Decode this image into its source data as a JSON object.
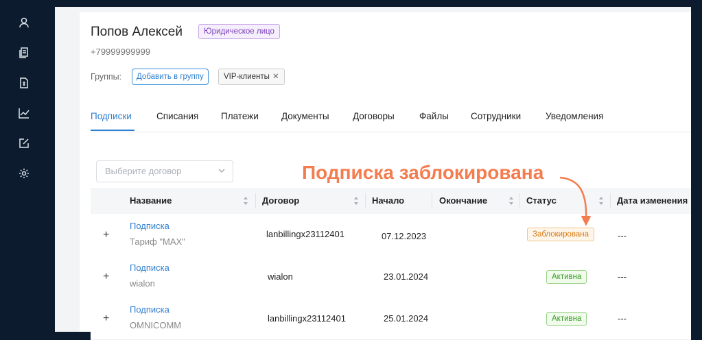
{
  "sidebar": {
    "icons": [
      "user-icon",
      "documents-icon",
      "invoice-icon",
      "chart-icon",
      "edit-icon",
      "gear-icon"
    ]
  },
  "client": {
    "name": "Попов Алексей",
    "type_badge": "Юридическое лицо",
    "phone": "+79999999999",
    "groups_label": "Группы:",
    "add_group_label": "Добавить в группу",
    "group_tag": "VIP-клиенты"
  },
  "tabs": [
    {
      "label": "Подписки"
    },
    {
      "label": "Списания"
    },
    {
      "label": "Платежи"
    },
    {
      "label": "Документы"
    },
    {
      "label": "Договоры"
    },
    {
      "label": "Файлы"
    },
    {
      "label": "Сотрудники"
    },
    {
      "label": "Уведомления"
    }
  ],
  "filter": {
    "placeholder": "Выберите договор"
  },
  "table": {
    "columns": [
      "Название",
      "Договор",
      "Начало",
      "Окончание",
      "Статус",
      "Дата изменения"
    ],
    "rows": [
      {
        "name": "Подписка",
        "tariff": "Тариф \"MAX\"",
        "contract": "lanbillingx23112401",
        "start": "07.12.2023",
        "end": "",
        "status": "Заблокирована",
        "changed": "---"
      },
      {
        "name": "Подписка",
        "tariff": "wialon",
        "contract": "wialon",
        "start": "23.01.2024",
        "end": "",
        "status": "Активна",
        "changed": "---"
      },
      {
        "name": "Подписка",
        "tariff": "OMNICOMM",
        "contract": "lanbillingx23112401",
        "start": "25.01.2024",
        "end": "",
        "status": "Активна",
        "changed": "---"
      }
    ]
  },
  "annotation": {
    "text": "Подписка заблокирована",
    "color": "#f47c4e"
  },
  "colors": {
    "accent": "#2f7fd0",
    "sidebar": "#0c1b2e"
  }
}
